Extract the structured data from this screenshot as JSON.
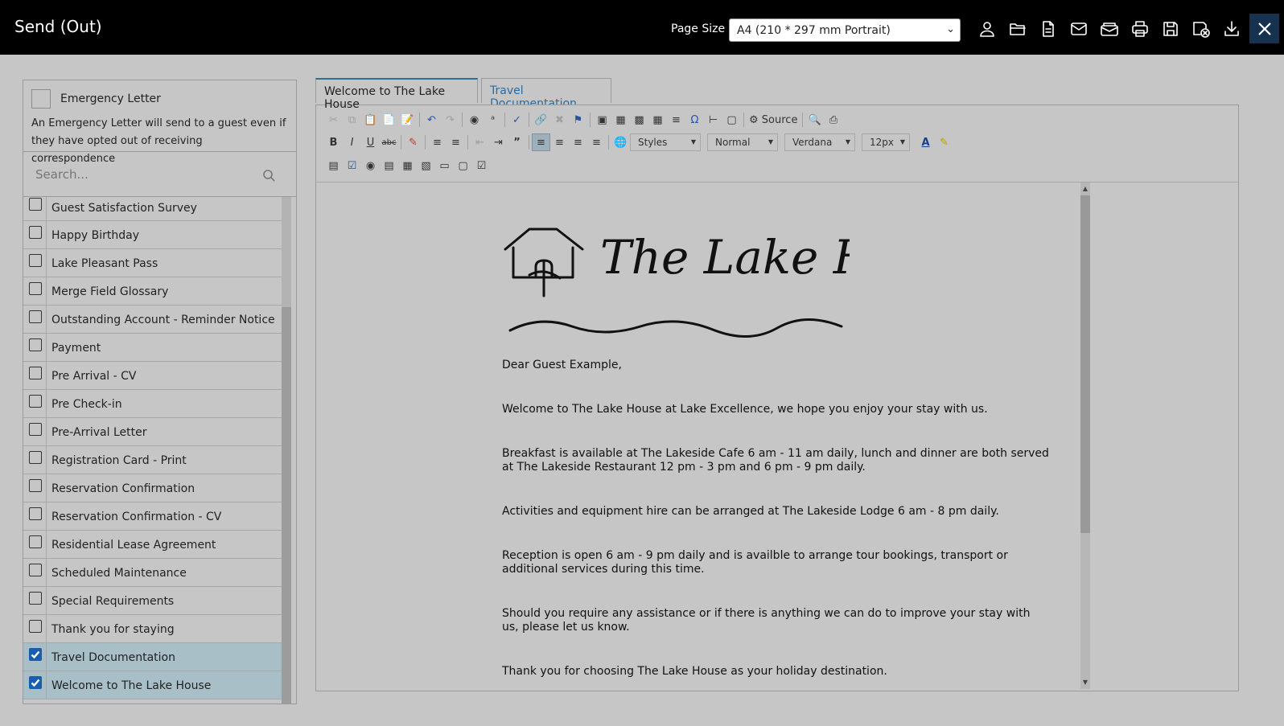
{
  "window": {
    "title": "Send (Out)",
    "page_size_label": "Page Size",
    "page_size_value": "A4 (210 * 297 mm Portrait)"
  },
  "toolbar_icons": [
    "user-icon",
    "folder-icon",
    "document-icon",
    "envelope-icon",
    "email-merge-icon",
    "printer-icon",
    "save-icon",
    "save-close-icon",
    "download-icon"
  ],
  "emergency": {
    "label": "Emergency Letter",
    "description": "An Emergency Letter will send to a guest even if they have opted out of receiving correspondence"
  },
  "search": {
    "placeholder": "Search..."
  },
  "letters": [
    {
      "label": "Guest Satisfaction Survey",
      "checked": false
    },
    {
      "label": "Happy Birthday",
      "checked": false
    },
    {
      "label": "Lake Pleasant Pass",
      "checked": false
    },
    {
      "label": "Merge Field Glossary",
      "checked": false
    },
    {
      "label": "Outstanding Account - Reminder Notice",
      "checked": false
    },
    {
      "label": "Payment",
      "checked": false
    },
    {
      "label": "Pre Arrival - CV",
      "checked": false
    },
    {
      "label": "Pre Check-in",
      "checked": false
    },
    {
      "label": "Pre-Arrival Letter",
      "checked": false
    },
    {
      "label": "Registration Card - Print",
      "checked": false
    },
    {
      "label": "Reservation Confirmation",
      "checked": false
    },
    {
      "label": "Reservation Confirmation - CV",
      "checked": false
    },
    {
      "label": "Residential Lease Agreement",
      "checked": false
    },
    {
      "label": "Scheduled Maintenance",
      "checked": false
    },
    {
      "label": "Special Requirements",
      "checked": false
    },
    {
      "label": "Thank you for staying",
      "checked": false
    },
    {
      "label": "Travel Documentation",
      "checked": true
    },
    {
      "label": "Welcome to The Lake House",
      "checked": true
    }
  ],
  "tabs": [
    {
      "label": "Welcome to The Lake House",
      "active": true
    },
    {
      "label": "Travel Documentation",
      "active": false
    }
  ],
  "editor": {
    "source_label": "Source",
    "styles": "Styles",
    "format": "Normal",
    "font": "Verdana",
    "size": "12px"
  },
  "document": {
    "logo_text": "The Lake House.",
    "paragraphs": [
      "Dear Guest Example,",
      "Welcome to The Lake House at Lake Excellence, we hope you enjoy your stay with us.",
      "Breakfast is available at The Lakeside Cafe 6 am - 11 am daily, lunch and dinner are both served at The Lakeside Restaurant 12 pm - 3 pm and 6 pm - 9 pm daily.",
      "Activities and equipment hire can be arranged at The Lakeside Lodge 6 am - 8 pm daily.",
      "Reception is open 6 am - 9 pm daily and is availble to arrange tour bookings, transport or additional services during this time.",
      "Should you require any assistance or if there is anything we can do to improve your stay with us, please let us know.",
      "Thank you for choosing The Lake House as your holiday destination."
    ]
  },
  "colors": {
    "topbar": "#000000",
    "close_button": "#16324f",
    "checked_row": "#a9bfc8",
    "checkbox_checked": "#1a5dad",
    "tab_inactive_text": "#2b6a9e"
  }
}
